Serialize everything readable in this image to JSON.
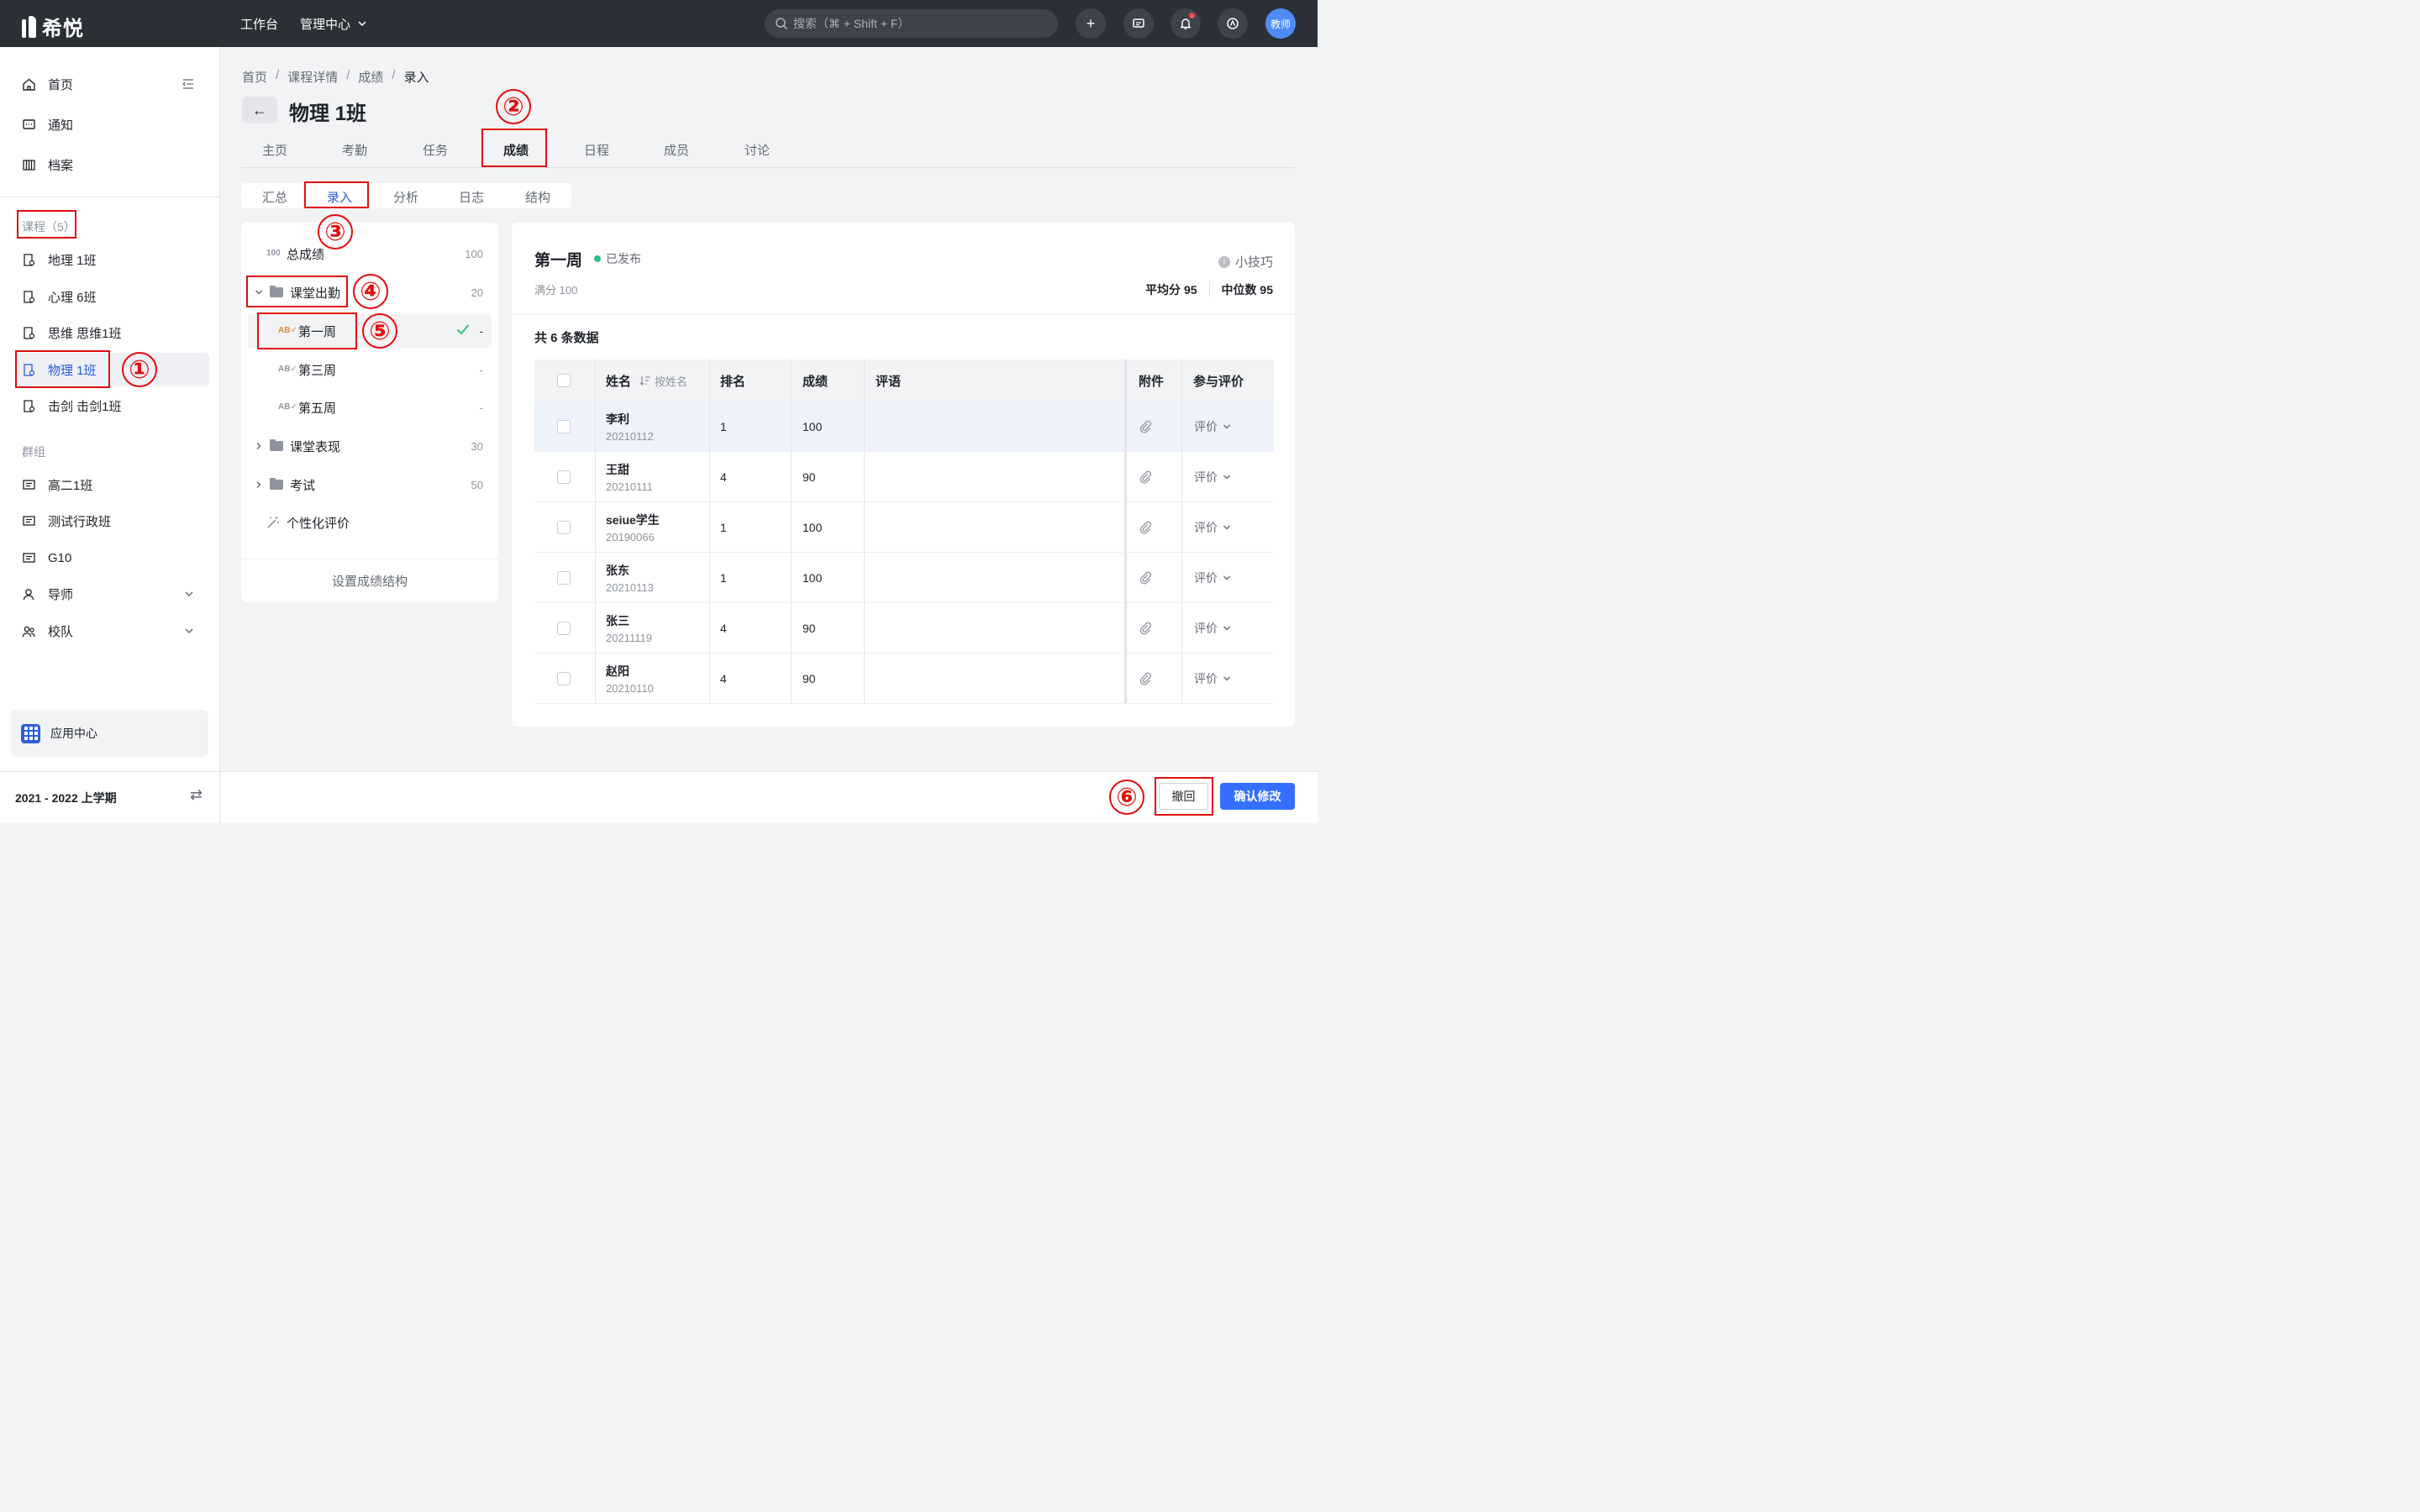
{
  "topbar": {
    "logo_text": "希悦",
    "nav": [
      "工作台",
      "管理中心"
    ],
    "search_placeholder": "搜索（⌘ + Shift + F）",
    "avatar_label": "教师"
  },
  "sidebar": {
    "main_items": [
      "首页",
      "通知",
      "档案"
    ],
    "courses_header": "课程（5）",
    "courses": [
      "地理 1班",
      "心理 6班",
      "思维 思维1班",
      "物理 1班",
      "击剑 击剑1班"
    ],
    "groups_header": "群组",
    "groups": [
      "高二1班",
      "测试行政班",
      "G10",
      "导师",
      "校队"
    ],
    "app_center": "应用中心",
    "term": "2021 - 2022 上学期"
  },
  "breadcrumb": [
    "首页",
    "课程详情",
    "成绩",
    "录入"
  ],
  "page_title": "物理 1班",
  "tabs": [
    "主页",
    "考勤",
    "任务",
    "成绩",
    "日程",
    "成员",
    "讨论"
  ],
  "subtabs": [
    "汇总",
    "录入",
    "分析",
    "日志",
    "结构"
  ],
  "tree": {
    "total": {
      "label": "总成绩",
      "count": "100",
      "icon": "100"
    },
    "items": [
      {
        "label": "课堂出勤",
        "count": "20"
      },
      {
        "label": "第一周",
        "count": "-"
      },
      {
        "label": "第三周",
        "count": "-"
      },
      {
        "label": "第五周",
        "count": "-"
      },
      {
        "label": "课堂表现",
        "count": "30"
      },
      {
        "label": "考试",
        "count": "50"
      },
      {
        "label": "个性化评价",
        "count": ""
      }
    ],
    "footer": "设置成绩结构"
  },
  "content": {
    "title": "第一周",
    "status": "已发布",
    "full_score": "满分 100",
    "tips": "小技巧",
    "avg": "平均分 95",
    "median": "中位数 95",
    "count_text": "共 6 条数据",
    "headers": {
      "name": "姓名",
      "sort": "按姓名",
      "rank": "排名",
      "score": "成绩",
      "comment": "评语",
      "attach": "附件",
      "eval": "参与评价"
    },
    "rows": [
      {
        "name": "李利",
        "id": "20210112",
        "rank": "1",
        "score": "100",
        "eval": "评价"
      },
      {
        "name": "王甜",
        "id": "20210111",
        "rank": "4",
        "score": "90",
        "eval": "评价"
      },
      {
        "name": "seiue学生",
        "id": "20190066",
        "rank": "1",
        "score": "100",
        "eval": "评价"
      },
      {
        "name": "张东",
        "id": "20210113",
        "rank": "1",
        "score": "100",
        "eval": "评价"
      },
      {
        "name": "张三",
        "id": "20211119",
        "rank": "4",
        "score": "90",
        "eval": "评价"
      },
      {
        "name": "赵阳",
        "id": "20210110",
        "rank": "4",
        "score": "90",
        "eval": "评价"
      }
    ]
  },
  "buttons": {
    "undo": "撤回",
    "confirm": "确认修改"
  },
  "annotations": [
    "①",
    "②",
    "③",
    "④",
    "⑤",
    "⑥"
  ],
  "colors": {
    "accent": "#3370ff",
    "highlight": "#e30d0d",
    "topbar": "#2b2f36",
    "published": "#2ec27e"
  }
}
